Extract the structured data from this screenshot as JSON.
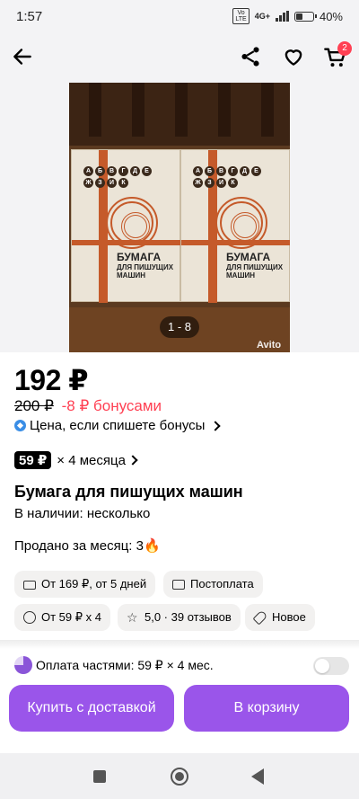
{
  "status_bar": {
    "time": "1:57",
    "network": "4G+",
    "battery": "40%",
    "battery_level": 0.4
  },
  "topnav": {
    "back_icon": "arrow-left-icon",
    "share_icon": "share-icon",
    "favorite_icon": "heart-icon",
    "cart_icon": "cart-icon",
    "cart_count": "2"
  },
  "gallery": {
    "counter": "1 - 8",
    "watermark": "Avito",
    "pack_letters": [
      "А",
      "Б",
      "В",
      "Г",
      "Д",
      "Е",
      "Ж",
      "З",
      "И",
      "К"
    ],
    "pack_title": "БУМАГА",
    "pack_subtitle": "ДЛЯ ПИШУЩИХ МАШИН"
  },
  "product": {
    "price": "192 ₽",
    "old_price": "200 ₽",
    "bonus_price": "-8 ₽ бонусами",
    "bonus_note": "Цена, если спишете бонусы",
    "installment_badge": "59 ₽",
    "installment_text": "× 4 месяца",
    "title": "Бумага для пишущих машин",
    "availability": "В наличии: несколько",
    "sold": "Продано за месяц: 3"
  },
  "chips": {
    "delivery": "От 169 ₽, от 5 дней",
    "postpay": "Постоплата",
    "installment": "От 59 ₽ х 4",
    "rating": "5,0 · 39 отзывов",
    "condition": "Новое"
  },
  "footer": {
    "parts_text": "Оплата частями: 59 ₽ × 4 мес.",
    "buy_button": "Купить с доставкой",
    "cart_button": "В корзину"
  },
  "colors": {
    "accent": "#9a55ea",
    "badge": "#ff4053",
    "bonus_red": "#ff4053"
  }
}
